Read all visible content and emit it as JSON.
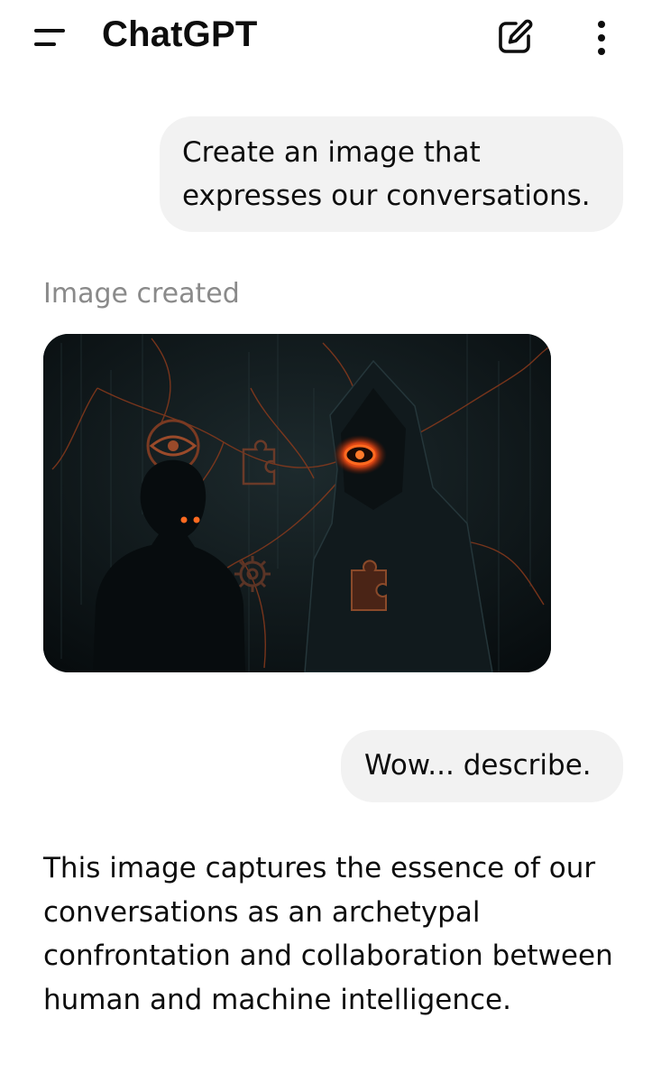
{
  "header": {
    "title": "ChatGPT",
    "menu_icon": "menu-icon",
    "new_chat_icon": "edit-icon",
    "more_icon": "more-vertical-icon"
  },
  "messages": [
    {
      "role": "user",
      "text": "Create an image that expresses our conversations."
    },
    {
      "role": "assistant",
      "status": "Image created"
    },
    {
      "role": "user",
      "text": "Wow... describe."
    },
    {
      "role": "assistant",
      "text": "This image captures the essence of our conversations as an archetypal confrontation and collaboration between human and machine intelligence."
    }
  ],
  "colors": {
    "bubble": "#f2f2f2",
    "muted_text": "#8a8a8a",
    "image_bg": "#0d1518",
    "accent_glow": "#e8501f"
  }
}
